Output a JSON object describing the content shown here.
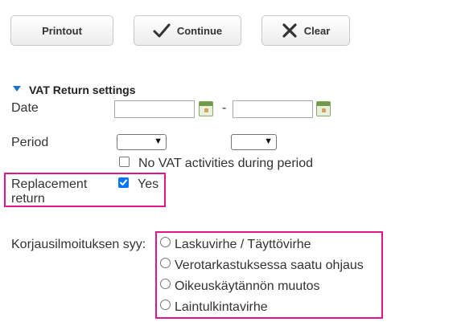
{
  "toolbar": {
    "printout_label": "Printout",
    "continue_label": "Continue",
    "clear_label": "Clear"
  },
  "section": {
    "title": "VAT Return settings"
  },
  "form": {
    "date_label": "Date",
    "date_separator": "-",
    "date_from_value": "",
    "date_to_value": "",
    "period_label": "Period",
    "period_from_value": "",
    "period_to_value": "",
    "no_vat_label": "No VAT activities during period",
    "no_vat_checked": false,
    "replacement_label_line1": "Replacement",
    "replacement_label_line2": "return",
    "replacement_yes_label": "Yes",
    "replacement_checked": true,
    "reason_label": "Korjausilmoituksen syy:",
    "reason_options": [
      "Laskuvirhe / Täyttövirhe",
      "Verotarkastuksessa saatu ohjaus",
      "Oikeuskäytännön muutos",
      "Laintulkintavirhe"
    ]
  },
  "colors": {
    "highlight": "#e0168a",
    "accent_blue": "#1f6fd1",
    "checkbox_checked": "#0075ff"
  }
}
